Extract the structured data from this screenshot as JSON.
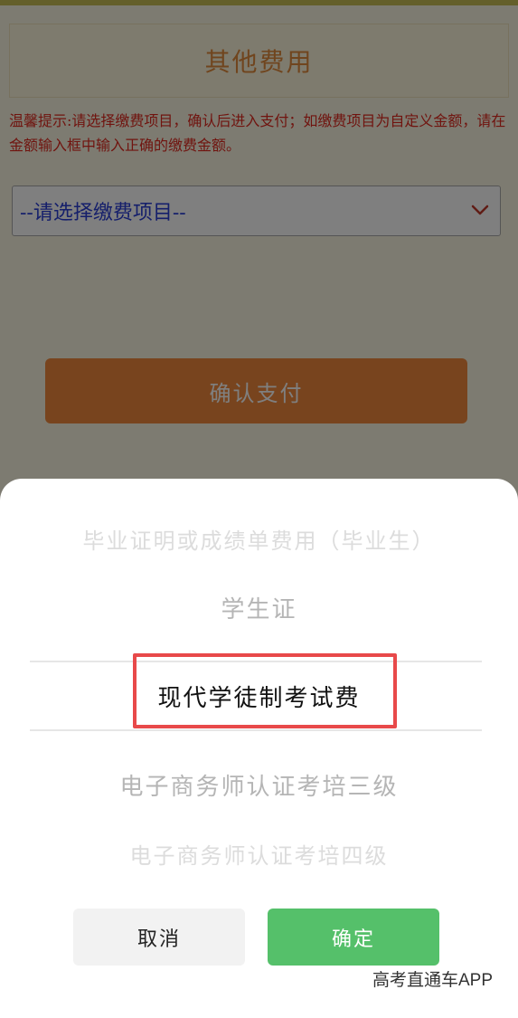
{
  "page": {
    "title": "其他费用",
    "hint": "温馨提示:请选择缴费项目，确认后进入支付；如缴费项目为自定义金额，请在金额输入框中输入正确的缴费金额。",
    "select_placeholder": "--请选择缴费项目--",
    "confirm_pay_label": "确认支付"
  },
  "picker": {
    "items": [
      "毕业证明或成绩单费用（毕业生）",
      "学生证",
      "现代学徒制考试费",
      "电子商务师认证考培三级",
      "电子商务师认证考培四级"
    ],
    "selected_index": 2,
    "cancel_label": "取消",
    "ok_label": "确定"
  },
  "watermark": "高考直通车APP",
  "colors": {
    "accent": "#f0893c",
    "ok_button": "#55c06a",
    "hint_text": "#e0281e",
    "highlight_border": "#e8494a"
  }
}
